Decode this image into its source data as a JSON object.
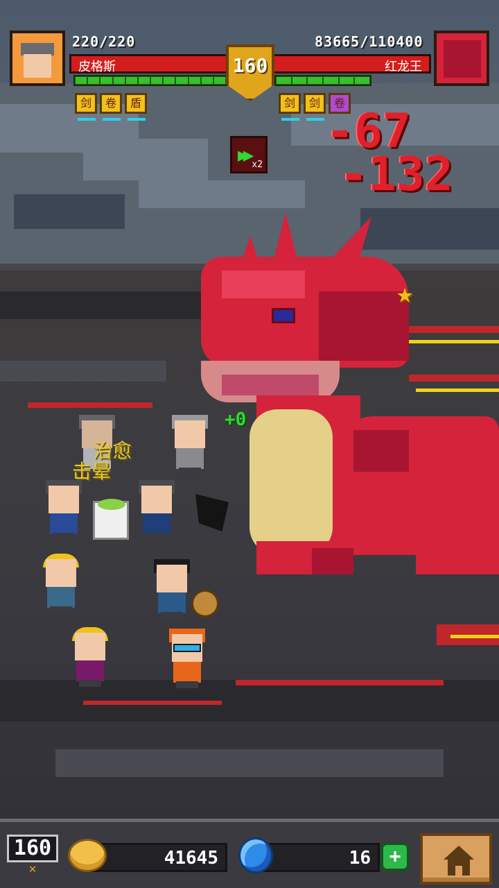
{
  "player": {
    "hp": "220/220",
    "name": "皮格斯",
    "level": "160"
  },
  "boss": {
    "hp": "83665/110400",
    "name": "红龙王"
  },
  "speed": {
    "multiplier": "x2"
  },
  "damage_numbers": [
    "-67",
    "-132"
  ],
  "heal_number": "+0",
  "status_texts": {
    "heal": "治愈",
    "stun": "击晕"
  },
  "player_buffs": [
    "剑",
    "卷",
    "盾"
  ],
  "boss_buffs": [
    "剑",
    "剑",
    "卷"
  ],
  "footer": {
    "level": "160",
    "coins": "41645",
    "gems": "16",
    "add_label": "+"
  },
  "colors": {
    "hp_red": "#d41d1d",
    "energy_green": "#37c02a",
    "level_gold": "#e1a51b",
    "dragon_red": "#d4233b"
  }
}
